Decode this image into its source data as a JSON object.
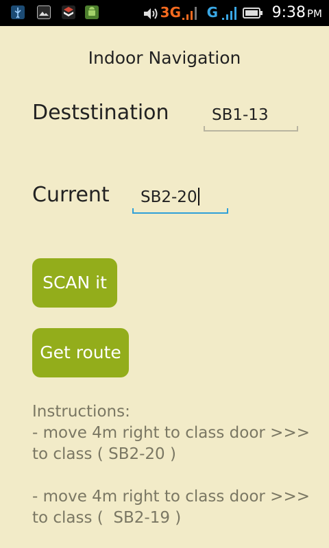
{
  "status_bar": {
    "network_3g": "3G",
    "network_g": "G",
    "time": "9:38",
    "ampm": "PM",
    "icons": [
      "usb-icon",
      "gallery-icon",
      "shield-icon",
      "android-icon",
      "volume-icon",
      "signal-icon",
      "battery-icon"
    ],
    "colors": {
      "network_3g": "#f36a1f",
      "network_g": "#3aa7e4"
    }
  },
  "app": {
    "title": "Indoor Navigation"
  },
  "form": {
    "destination_label": "Deststination",
    "destination_value": "SB1-13",
    "current_label": "Current",
    "current_value": "SB2-20"
  },
  "buttons": {
    "scan_label": "SCAN it",
    "route_label": "Get route",
    "color": "#93ad1b"
  },
  "instructions": {
    "heading": "Instructions:",
    "steps": [
      "- move 4m right to class door >>>\nto class ( SB2-20 )",
      "- move 4m right to class door >>>\nto class (  SB2-19 )"
    ]
  },
  "theme": {
    "background": "#f2ebc8",
    "focus_color": "#2f9fd8"
  }
}
